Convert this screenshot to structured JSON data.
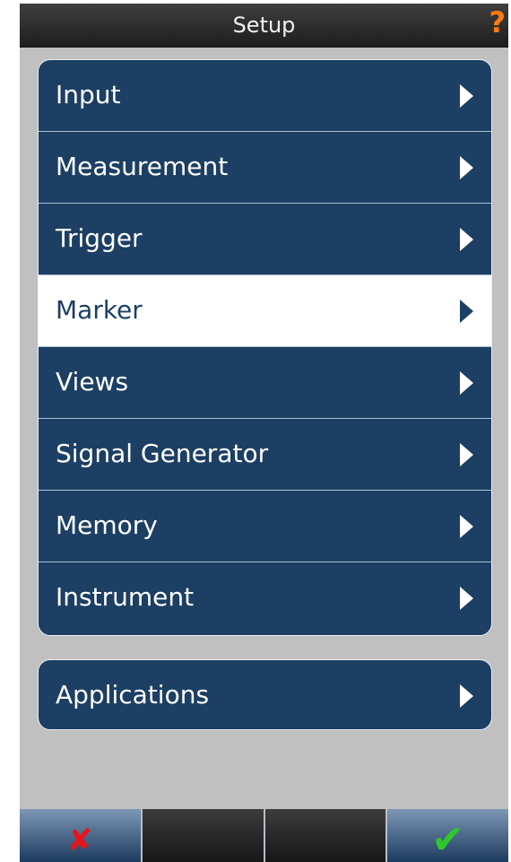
{
  "header": {
    "title": "Setup",
    "help_glyph": "?"
  },
  "menu": {
    "items": [
      {
        "label": "Input"
      },
      {
        "label": "Measurement"
      },
      {
        "label": "Trigger"
      },
      {
        "label": "Marker",
        "selected": true
      },
      {
        "label": "Views"
      },
      {
        "label": "Signal Generator"
      },
      {
        "label": "Memory"
      },
      {
        "label": "Instrument"
      }
    ],
    "applications": {
      "label": "Applications"
    }
  },
  "softkeys": {
    "cancel_glyph": "✘",
    "ok_glyph": "✔"
  },
  "colors": {
    "menu_background": "#1c3f63",
    "selected_background": "#ffffff",
    "help_icon": "#ff7a12",
    "cancel_icon": "#e8141c",
    "ok_icon": "#2bc92b"
  }
}
